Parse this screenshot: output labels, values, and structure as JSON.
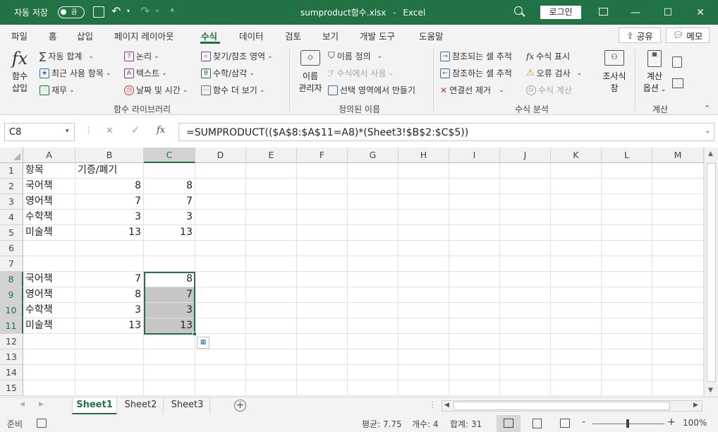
{
  "titlebar": {
    "autosave_label": "자동 저장",
    "autosave_state": "끔",
    "filename": "sumproduct함수.xlsx",
    "app_sep": "-",
    "app_name": "Excel",
    "login_label": "로그인"
  },
  "menu": {
    "tabs": [
      "파일",
      "홈",
      "삽입",
      "페이지 레이아웃",
      "수식",
      "데이터",
      "검토",
      "보기",
      "개발 도구",
      "도움말"
    ],
    "active": "수식",
    "share_label": "공유",
    "memo_label": "메모"
  },
  "ribbon": {
    "insert_fn_top": "함수",
    "insert_fn_bottom": "삽입",
    "autosum": "자동 합계",
    "recent": "최근 사용 항목",
    "financial": "재무",
    "logical": "논리",
    "text": "텍스트",
    "datetime": "날짜 및 시간",
    "lookup": "찾기/참조 영역",
    "math": "수학/삼각",
    "more": "함수 더 보기",
    "group_library": "함수 라이브러리",
    "name_mgr_top": "이름",
    "name_mgr_bottom": "관리자",
    "define_name": "이름 정의",
    "use_in_formula": "수식에서 사용",
    "create_from_sel": "선택 영역에서 만들기",
    "group_names": "정의된 이름",
    "trace_precedents": "참조되는 셀 추적",
    "trace_dependents": "참조하는 셀 추적",
    "remove_arrows": "연결선 제거",
    "show_formulas": "수식 표시",
    "error_check": "오류 검사",
    "evaluate": "수식 계산",
    "group_audit": "수식 분석",
    "watch_top": "조사식",
    "watch_bottom": "창",
    "calc_top": "계산",
    "calc_bottom": "옵션",
    "group_calc": "계산"
  },
  "formula_bar": {
    "name_box": "C8",
    "fx": "fx",
    "formula": "=SUMPRODUCT(($A$8:$A$11=A8)*(Sheet3!$B$2:$C$5))"
  },
  "grid": {
    "columns": [
      "A",
      "B",
      "C",
      "D",
      "E",
      "F",
      "G",
      "H",
      "I",
      "J",
      "K",
      "L",
      "M"
    ],
    "rows": [
      "1",
      "2",
      "3",
      "4",
      "5",
      "6",
      "7",
      "8",
      "9",
      "10",
      "11",
      "12",
      "13",
      "14",
      "15"
    ],
    "A1": "항목",
    "B1": "기증/폐기",
    "A2": "국어책",
    "B2": "8",
    "C2": "8",
    "A3": "영어책",
    "B3": "7",
    "C3": "7",
    "A4": "수학책",
    "B4": "3",
    "C4": "3",
    "A5": "미술책",
    "B5": "13",
    "C5": "13",
    "A8": "국어책",
    "B8": "7",
    "C8": "8",
    "A9": "영어책",
    "B9": "8",
    "C9": "7",
    "A10": "수학책",
    "B10": "3",
    "C10": "3",
    "A11": "미술책",
    "B11": "13",
    "C11": "13"
  },
  "sheets": {
    "tabs": [
      "Sheet1",
      "Sheet2",
      "Sheet3"
    ],
    "active": "Sheet1",
    "add": "+"
  },
  "status": {
    "ready": "준비",
    "average": "평균: 7.75",
    "count": "개수: 4",
    "sum": "합계: 31",
    "zoom_minus": "-",
    "zoom_plus": "+",
    "zoom": "100%"
  },
  "colors": {
    "excel_green": "#217346",
    "active_tab_green": "#217346",
    "selection_gray": "#c6c6c6",
    "selection_border": "#217346"
  }
}
